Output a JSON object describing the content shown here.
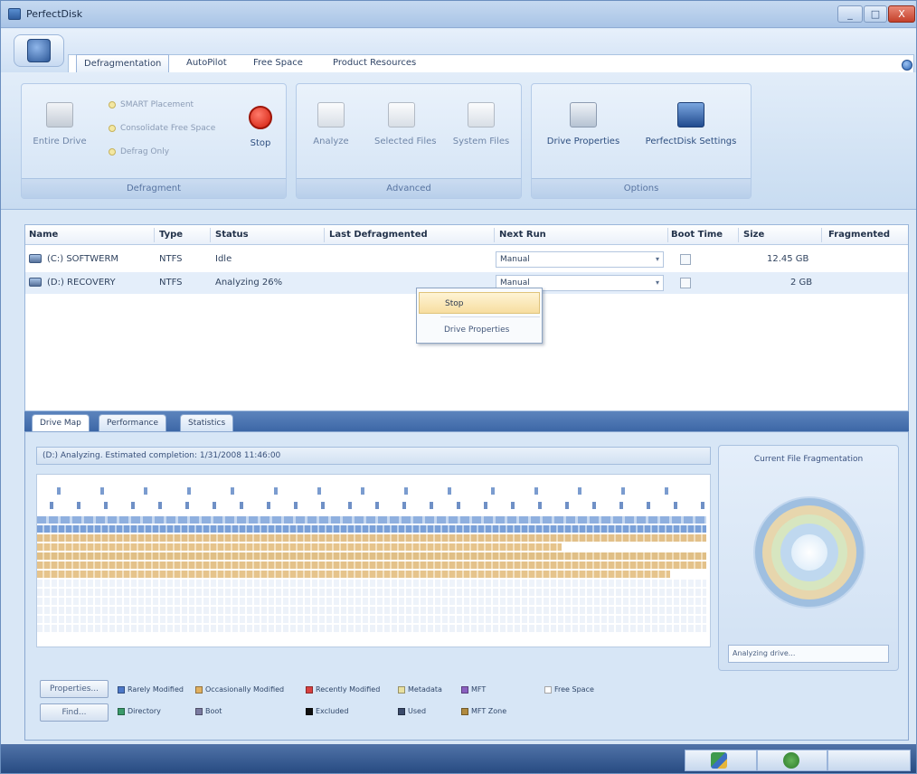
{
  "window": {
    "title": "PerfectDisk",
    "controls": [
      "_",
      "□",
      "X"
    ]
  },
  "ribbon": {
    "tabs": [
      "Defragmentation",
      "AutoPilot",
      "Free Space",
      "Product Resources"
    ],
    "active_tab": 0,
    "groups": [
      {
        "label": "Defragment",
        "buttons": [
          "Entire Drive",
          "Stop"
        ],
        "options": [
          "SMART Placement",
          "Consolidate Free Space",
          "Defrag Only"
        ]
      },
      {
        "label": "Advanced",
        "buttons": [
          "Analyze",
          "Selected Files",
          "System Files"
        ]
      },
      {
        "label": "Options",
        "buttons": [
          "Drive Properties",
          "PerfectDisk Settings"
        ]
      }
    ]
  },
  "drives": {
    "columns": [
      "Name",
      "Type",
      "Status",
      "Last Defragmented",
      "Next Run",
      "Boot Time",
      "Size",
      "Fragmented"
    ],
    "rows": [
      {
        "name": "(C:) SOFTWERM",
        "type": "NTFS",
        "status": "Idle",
        "last": "",
        "next_run": "Manual",
        "size": "12.45 GB",
        "fragmented": ""
      },
      {
        "name": "(D:) RECOVERY",
        "type": "NTFS",
        "status": "Analyzing 26%",
        "last": "",
        "next_run": "Manual",
        "size": "2 GB",
        "fragmented": ""
      }
    ]
  },
  "context_menu": {
    "items": [
      "Stop",
      "Drive Properties"
    ]
  },
  "lower_tabs": [
    "Drive Map",
    "Performance",
    "Statistics"
  ],
  "drive_map": {
    "status_text": "(D:) Analyzing. Estimated completion: 1/31/2008 11:46:00",
    "buttons": [
      "Properties...",
      "Find..."
    ],
    "legend": [
      {
        "label": "Rarely Modified",
        "color": "#4c78c8"
      },
      {
        "label": "Occasionally Modified",
        "color": "#e0b060"
      },
      {
        "label": "Recently Modified",
        "color": "#d84040"
      },
      {
        "label": "Metadata",
        "color": "#e8e0a0"
      },
      {
        "label": "MFT",
        "color": "#8a60c0"
      },
      {
        "label": "Free Space",
        "color": "#ffffff"
      },
      {
        "label": "Directory",
        "color": "#3a9a6a"
      },
      {
        "label": "Boot",
        "color": "#7a7aa0"
      },
      {
        "label": "Excluded",
        "color": "#101010"
      },
      {
        "label": "Used",
        "color": "#3a4a6a"
      },
      {
        "label": "MFT Zone",
        "color": "#b08a40"
      }
    ],
    "fragmentation_title": "Current File Fragmentation",
    "fragmentation_status": "Analyzing drive..."
  },
  "statusbar": {
    "icons": [
      "update-icon",
      "recycle-icon"
    ]
  }
}
